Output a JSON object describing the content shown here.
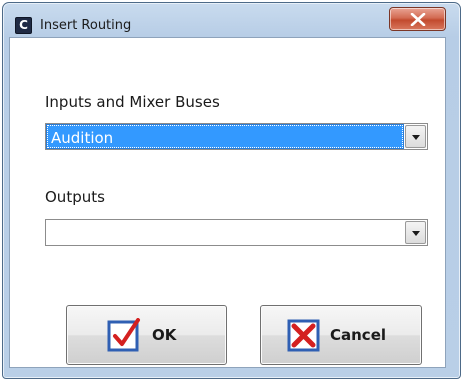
{
  "window": {
    "title": "Insert Routing",
    "app_icon_letter": "C",
    "close_icon": "close-x-icon"
  },
  "inputs": {
    "label": "Inputs and Mixer Buses",
    "selected_value": "Audition",
    "dropdown_icon": "chevron-down-icon"
  },
  "outputs": {
    "label": "Outputs",
    "selected_value": "",
    "dropdown_icon": "chevron-down-icon"
  },
  "buttons": {
    "ok_label": "OK",
    "ok_icon": "checkmark-icon",
    "cancel_label": "Cancel",
    "cancel_icon": "x-mark-icon"
  },
  "colors": {
    "selection_highlight": "#3399ff",
    "close_button": "#c24a2e",
    "icon_blue": "#2f5fb3",
    "icon_red": "#d42020"
  }
}
